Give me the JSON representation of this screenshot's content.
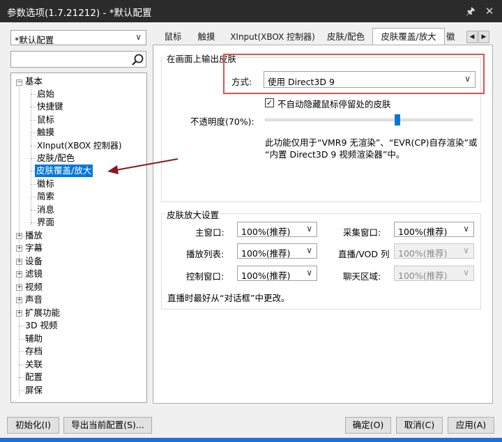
{
  "window": {
    "title": "参数选项(1.7.21212) - *默认配置"
  },
  "profile": {
    "selected": "*默认配置"
  },
  "search": {
    "value": ""
  },
  "tree": {
    "basic": "基本",
    "basic_children": [
      "启始",
      "快捷键",
      "鼠标",
      "触摸",
      "XInput(XBOX 控制器)",
      "皮肤/配色",
      "皮肤覆盖/放大",
      "徽标",
      "简索",
      "消息",
      "界面"
    ],
    "collapsed": [
      "播放",
      "字幕",
      "设备",
      "滤镜",
      "视频",
      "声音",
      "扩展功能"
    ],
    "leaves": [
      "3D 视频",
      "辅助",
      "存档",
      "关联",
      "配置",
      "屏保"
    ]
  },
  "tabs": [
    "鼠标",
    "触摸",
    "XInput(XBOX 控制器)",
    "皮肤/配色",
    "皮肤覆盖/放大",
    "徽"
  ],
  "output_group": {
    "title": "在画面上输出皮肤",
    "method_label": "方式:",
    "method_value": "使用 Direct3D 9",
    "checkbox_label": "不自动隐藏鼠标停留处的皮肤",
    "checkbox_checked": true,
    "opacity_label": "不透明度(70%):",
    "opacity_value": 0.7,
    "note_line1": "此功能仅用于“VMR9 无渲染”、“EVR(CP)自存渲染”或",
    "note_line2": "“内置 Direct3D 9 视频渲染器”中。"
  },
  "zoom_group": {
    "title": "皮肤放大设置",
    "main_window_label": "主窗口:",
    "main_window_value": "100%(推荐)",
    "capture_window_label": "采集窗口:",
    "capture_window_value": "100%(推荐)",
    "playlist_label": "播放列表:",
    "playlist_value": "100%(推荐)",
    "live_list_label": "直播/VOD 列",
    "live_list_value": "100%(推荐)",
    "control_window_label": "控制窗口:",
    "control_window_value": "100%(推荐)",
    "chat_label": "聊天区域:",
    "chat_value": "100%(推荐)",
    "note": "直播时最好从“对话框”中更改。"
  },
  "buttons": {
    "init": "初始化(I)",
    "export": "导出当前配置(S)...",
    "ok": "确定(O)",
    "cancel": "取消(C)",
    "apply": "应用(A)"
  },
  "icons": {
    "pin": "pin-icon",
    "close": "close-icon",
    "search": "search-icon"
  },
  "colors": {
    "titlebar": "#2b2b2b",
    "selection": "#0078d7",
    "highlight_box": "#d9534f",
    "annotation_arrow": "#8b1a1a"
  }
}
